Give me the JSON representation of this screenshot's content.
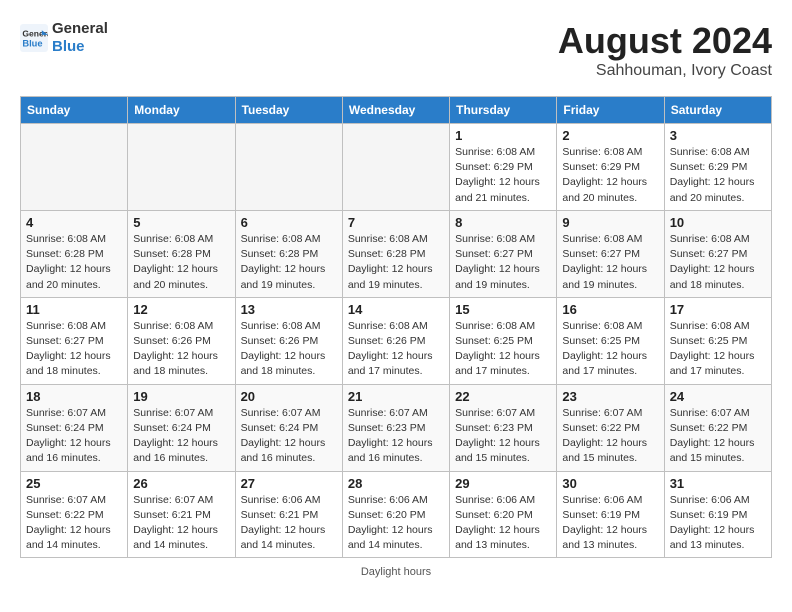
{
  "header": {
    "logo_line1": "General",
    "logo_line2": "Blue",
    "main_title": "August 2024",
    "subtitle": "Sahhouman, Ivory Coast"
  },
  "days_of_week": [
    "Sunday",
    "Monday",
    "Tuesday",
    "Wednesday",
    "Thursday",
    "Friday",
    "Saturday"
  ],
  "weeks": [
    [
      {
        "day": "",
        "info": ""
      },
      {
        "day": "",
        "info": ""
      },
      {
        "day": "",
        "info": ""
      },
      {
        "day": "",
        "info": ""
      },
      {
        "day": "1",
        "info": "Sunrise: 6:08 AM\nSunset: 6:29 PM\nDaylight: 12 hours and 21 minutes."
      },
      {
        "day": "2",
        "info": "Sunrise: 6:08 AM\nSunset: 6:29 PM\nDaylight: 12 hours and 20 minutes."
      },
      {
        "day": "3",
        "info": "Sunrise: 6:08 AM\nSunset: 6:29 PM\nDaylight: 12 hours and 20 minutes."
      }
    ],
    [
      {
        "day": "4",
        "info": "Sunrise: 6:08 AM\nSunset: 6:28 PM\nDaylight: 12 hours and 20 minutes."
      },
      {
        "day": "5",
        "info": "Sunrise: 6:08 AM\nSunset: 6:28 PM\nDaylight: 12 hours and 20 minutes."
      },
      {
        "day": "6",
        "info": "Sunrise: 6:08 AM\nSunset: 6:28 PM\nDaylight: 12 hours and 19 minutes."
      },
      {
        "day": "7",
        "info": "Sunrise: 6:08 AM\nSunset: 6:28 PM\nDaylight: 12 hours and 19 minutes."
      },
      {
        "day": "8",
        "info": "Sunrise: 6:08 AM\nSunset: 6:27 PM\nDaylight: 12 hours and 19 minutes."
      },
      {
        "day": "9",
        "info": "Sunrise: 6:08 AM\nSunset: 6:27 PM\nDaylight: 12 hours and 19 minutes."
      },
      {
        "day": "10",
        "info": "Sunrise: 6:08 AM\nSunset: 6:27 PM\nDaylight: 12 hours and 18 minutes."
      }
    ],
    [
      {
        "day": "11",
        "info": "Sunrise: 6:08 AM\nSunset: 6:27 PM\nDaylight: 12 hours and 18 minutes."
      },
      {
        "day": "12",
        "info": "Sunrise: 6:08 AM\nSunset: 6:26 PM\nDaylight: 12 hours and 18 minutes."
      },
      {
        "day": "13",
        "info": "Sunrise: 6:08 AM\nSunset: 6:26 PM\nDaylight: 12 hours and 18 minutes."
      },
      {
        "day": "14",
        "info": "Sunrise: 6:08 AM\nSunset: 6:26 PM\nDaylight: 12 hours and 17 minutes."
      },
      {
        "day": "15",
        "info": "Sunrise: 6:08 AM\nSunset: 6:25 PM\nDaylight: 12 hours and 17 minutes."
      },
      {
        "day": "16",
        "info": "Sunrise: 6:08 AM\nSunset: 6:25 PM\nDaylight: 12 hours and 17 minutes."
      },
      {
        "day": "17",
        "info": "Sunrise: 6:08 AM\nSunset: 6:25 PM\nDaylight: 12 hours and 17 minutes."
      }
    ],
    [
      {
        "day": "18",
        "info": "Sunrise: 6:07 AM\nSunset: 6:24 PM\nDaylight: 12 hours and 16 minutes."
      },
      {
        "day": "19",
        "info": "Sunrise: 6:07 AM\nSunset: 6:24 PM\nDaylight: 12 hours and 16 minutes."
      },
      {
        "day": "20",
        "info": "Sunrise: 6:07 AM\nSunset: 6:24 PM\nDaylight: 12 hours and 16 minutes."
      },
      {
        "day": "21",
        "info": "Sunrise: 6:07 AM\nSunset: 6:23 PM\nDaylight: 12 hours and 16 minutes."
      },
      {
        "day": "22",
        "info": "Sunrise: 6:07 AM\nSunset: 6:23 PM\nDaylight: 12 hours and 15 minutes."
      },
      {
        "day": "23",
        "info": "Sunrise: 6:07 AM\nSunset: 6:22 PM\nDaylight: 12 hours and 15 minutes."
      },
      {
        "day": "24",
        "info": "Sunrise: 6:07 AM\nSunset: 6:22 PM\nDaylight: 12 hours and 15 minutes."
      }
    ],
    [
      {
        "day": "25",
        "info": "Sunrise: 6:07 AM\nSunset: 6:22 PM\nDaylight: 12 hours and 14 minutes."
      },
      {
        "day": "26",
        "info": "Sunrise: 6:07 AM\nSunset: 6:21 PM\nDaylight: 12 hours and 14 minutes."
      },
      {
        "day": "27",
        "info": "Sunrise: 6:06 AM\nSunset: 6:21 PM\nDaylight: 12 hours and 14 minutes."
      },
      {
        "day": "28",
        "info": "Sunrise: 6:06 AM\nSunset: 6:20 PM\nDaylight: 12 hours and 14 minutes."
      },
      {
        "day": "29",
        "info": "Sunrise: 6:06 AM\nSunset: 6:20 PM\nDaylight: 12 hours and 13 minutes."
      },
      {
        "day": "30",
        "info": "Sunrise: 6:06 AM\nSunset: 6:19 PM\nDaylight: 12 hours and 13 minutes."
      },
      {
        "day": "31",
        "info": "Sunrise: 6:06 AM\nSunset: 6:19 PM\nDaylight: 12 hours and 13 minutes."
      }
    ]
  ],
  "footer": "Daylight hours"
}
